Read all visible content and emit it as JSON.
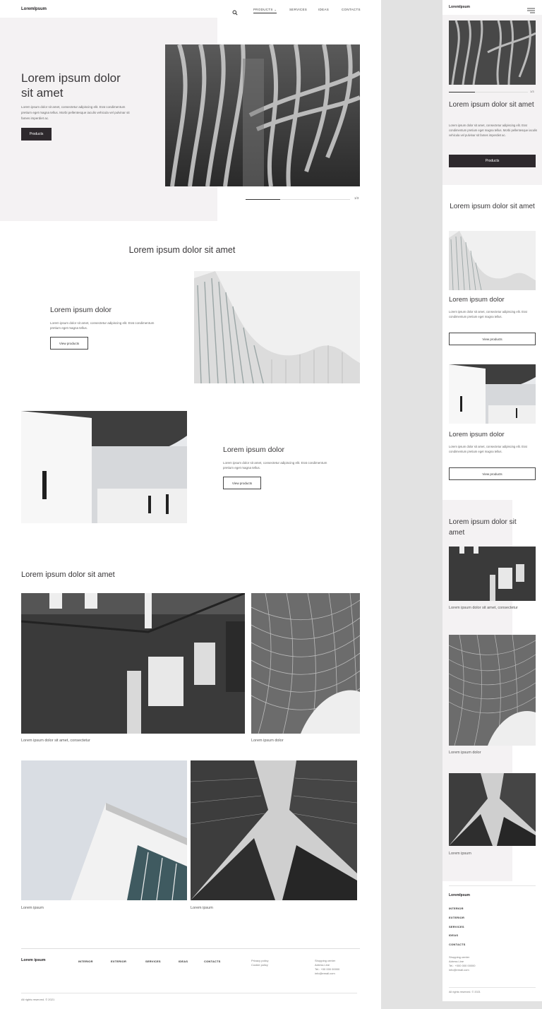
{
  "brand": "LoremIpsum",
  "nav": {
    "products": "PRODUCTS",
    "services": "SERVICES",
    "ideas": "IDEAS",
    "contacts": "CONTACTS"
  },
  "hero": {
    "title_line1": "Lorem ipsum dolor",
    "title_line2": "sit amet",
    "text": "Lorem ipsum  dolor sit amet, consectetur adipiscing elit. Erat condimentum pretium eget magna tellus. Morbi pellentesque iaculis vehicula vel pulvinar sit fames imperdiet ac.",
    "button": "Products",
    "slider_counter": "1/3",
    "slider_progress": 0.33
  },
  "section_title": "Lorem ipsum dolor sit amet",
  "features": [
    {
      "title": "Lorem ipsum dolor",
      "text": "Lorem ipsum dolor sit amet, consectetur adipiscing elit. Erat condimentum pretium eget magna tellus.",
      "button": "View products"
    },
    {
      "title": "Lorem ipsum dolor",
      "text": "Lorem ipsum dolor sit amet, consectetur adipiscing elit. Erat condimentum pretium eget magna tellus.",
      "button": "View products"
    }
  ],
  "gallery": {
    "title": "Lorem ipsum dolor sit amet",
    "captions": [
      "Lorem ipsum dolor sit amet, consectetur",
      "Lorem ipsum dolor",
      "Lorem ipsum",
      "Lorem ipsum"
    ]
  },
  "footer": {
    "brand": "Lorem ipsum",
    "links": [
      "INTERIOR",
      "EXTERIOR",
      "SERVICES",
      "IDEAS",
      "CONTACTS"
    ],
    "policies": [
      "Privacy policy",
      "Cookie policy"
    ],
    "contact": [
      "Shopping center",
      "Adress Line",
      "Tel.: +00 000 00000",
      "info@email.com"
    ],
    "copyright": "All rights reserved. © 2021"
  },
  "mobile": {
    "brand": "LoremIpsum",
    "hero_title": "Lorem ipsum dolor sit amet",
    "hero_text": "Lorem ipsum  dolor sit amet, consectetur adipiscing elit. Erat condimentum pretium eget magna tellus. Morbi pellentesque iaculis vehicula vel pulvinar sit fames imperdiet ac.",
    "hero_button": "Products",
    "slider_counter": "1/3",
    "section_title": "Lorem ipsum dolor sit amet",
    "features": [
      {
        "title": "Lorem ipsum dolor",
        "text": "Lorem ipsum dolor sit amet, consectetur adipiscing elit. Erat condimentum pretium eget magna tellus.",
        "button": "View products"
      },
      {
        "title": "Lorem ipsum dolor",
        "text": "Lorem ipsum dolor sit amet, consectetur adipiscing elit. Erat condimentum pretium eget magna tellus.",
        "button": "View products"
      }
    ],
    "gallery_title": "Lorem ipsum dolor sit amet",
    "gallery_captions": [
      "Lorem ipsum dolor sit amet, consectetur",
      "Lorem ipsum dolor",
      "Lorem ipsum"
    ],
    "footer_brand": "LoremIpsum",
    "footer_links": [
      "INTERIOR",
      "EXTERIOR",
      "SERVICES",
      "IDEAS",
      "CONTACTS"
    ],
    "footer_contact": [
      "Shopping center",
      "Adress Line",
      "Tel.: +000 000 00000",
      "info@email.com"
    ],
    "copyright": "All rights reserved. © 2021"
  },
  "icons": {
    "search": "search-icon",
    "menu": "menu-icon",
    "chevron": "chevron-down-icon"
  }
}
